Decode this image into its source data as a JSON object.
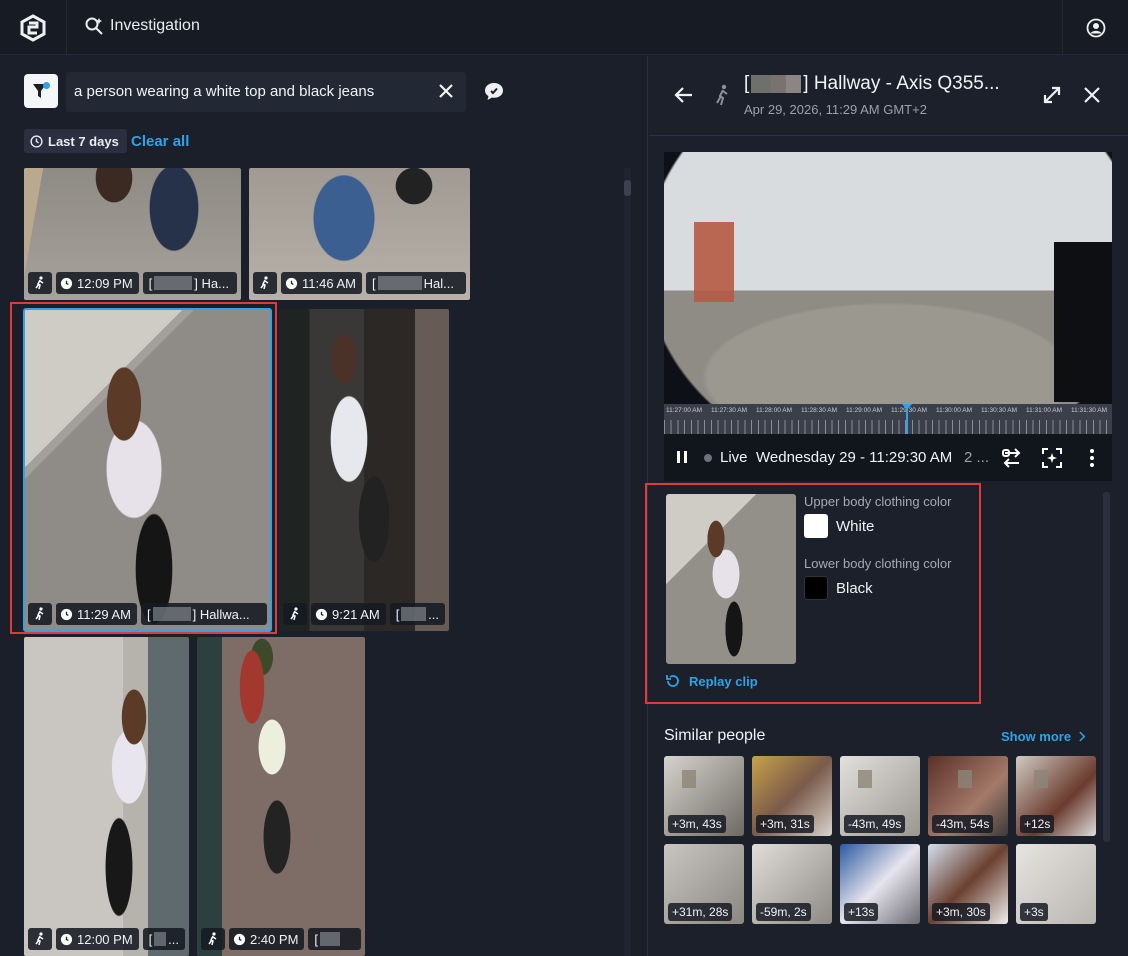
{
  "app": {
    "title": "Investigation"
  },
  "search": {
    "query": "a person wearing a white top and black jeans",
    "time_filter": "Last 7 days",
    "clear_all": "Clear all"
  },
  "results": [
    {
      "time": "12:09 PM",
      "camera": "[ ] Ha..."
    },
    {
      "time": "11:46 AM",
      "camera": "[ Hal..."
    },
    {
      "time": "11:29 AM",
      "camera": "[ ] Hallwa..."
    },
    {
      "time": "9:21 AM",
      "camera": "[ ..."
    },
    {
      "time": "12:00 PM",
      "camera": "[ ..."
    },
    {
      "time": "2:40 PM",
      "camera": "[ "
    }
  ],
  "detail": {
    "title": "] Hallway - Axis Q355...",
    "title_prefix": "[",
    "date": "Apr 29, 2026, 11:29 AM GMT+2",
    "timeline_labels": [
      "11:27:00 AM",
      "11:27:30 AM",
      "11:28:00 AM",
      "11:28:30 AM",
      "11:29:00 AM",
      "11:29:30 AM",
      "11:30:00 AM",
      "11:30:30 AM",
      "11:31:00 AM",
      "11:31:30 AM"
    ],
    "live_label": "Live",
    "video_time": "Wednesday 29 - 11:29:30 AM",
    "video_time_more": "2 ...",
    "upper_label": "Upper body clothing color",
    "upper_value": "White",
    "upper_color": "#ffffff",
    "lower_label": "Lower body clothing color",
    "lower_value": "Black",
    "lower_color": "#000000",
    "replay": "Replay clip"
  },
  "similar": {
    "title": "Similar people",
    "show_more": "Show more",
    "items": [
      "+3m, 43s",
      "+3m, 31s",
      "-43m, 49s",
      "-43m, 54s",
      "+12s",
      "+31m, 28s",
      "-59m, 2s",
      "+13s",
      "+3m, 30s",
      "+3s"
    ]
  }
}
